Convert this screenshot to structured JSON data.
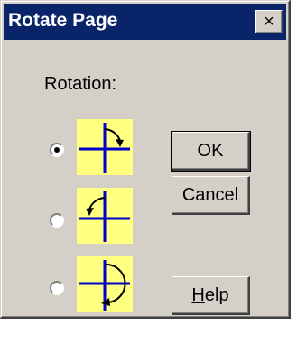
{
  "window": {
    "title": "Rotate Page",
    "close_glyph": "×"
  },
  "rotation": {
    "label": "Rotation:",
    "options": [
      {
        "icon": "rotate-clockwise-icon",
        "selected": true
      },
      {
        "icon": "rotate-counterclockwise-icon",
        "selected": false
      },
      {
        "icon": "rotate-180-icon",
        "selected": false
      }
    ]
  },
  "buttons": {
    "ok_label": "OK",
    "cancel_label": "Cancel",
    "help_mnemonic": "H",
    "help_rest": "elp"
  },
  "colors": {
    "title_bar": "#0a246a",
    "dialog_face": "#d4d0c8",
    "icon_background": "#ffff80",
    "icon_lines": "#0000cc"
  }
}
